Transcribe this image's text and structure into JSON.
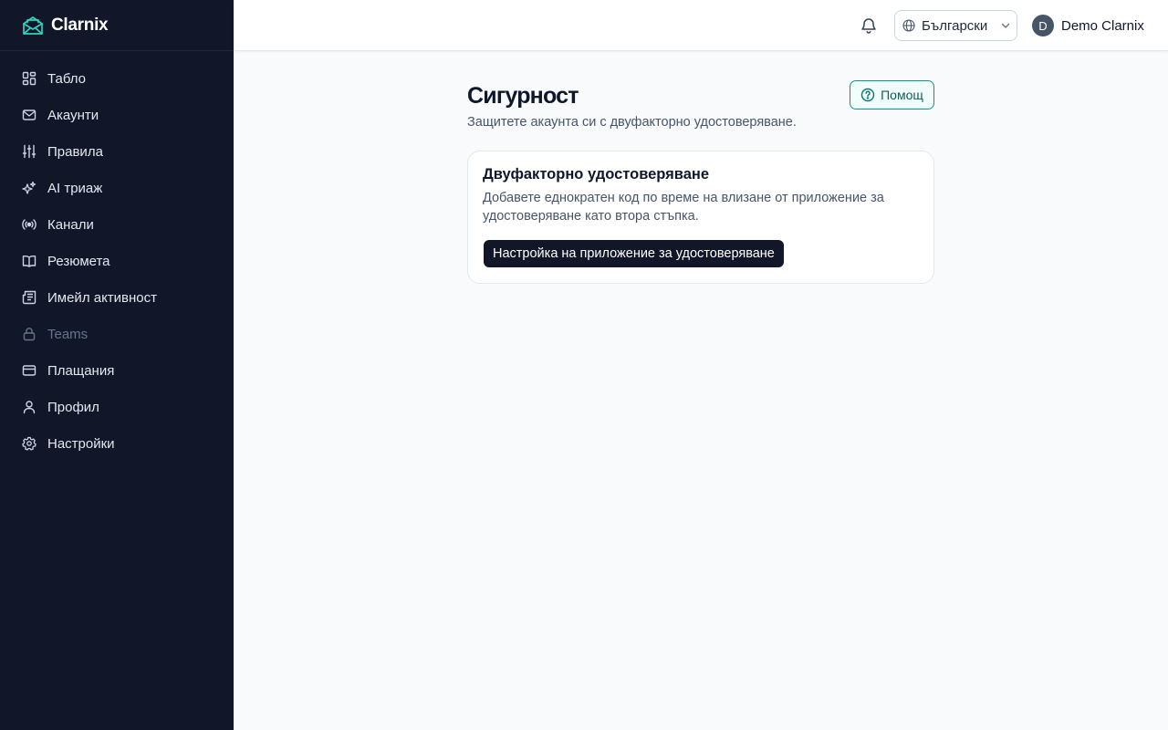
{
  "brand": {
    "name": "Clarnix",
    "accent": "#2dd4bf"
  },
  "sidebar": {
    "items": [
      {
        "label": "Табло",
        "icon": "dashboard-icon"
      },
      {
        "label": "Акаунти",
        "icon": "mail-icon"
      },
      {
        "label": "Правила",
        "icon": "sliders-icon"
      },
      {
        "label": "AI триаж",
        "icon": "sparkles-icon"
      },
      {
        "label": "Канали",
        "icon": "radio-icon"
      },
      {
        "label": "Резюмета",
        "icon": "book-icon"
      },
      {
        "label": "Имейл активност",
        "icon": "newspaper-icon"
      },
      {
        "label": "Teams",
        "icon": "lock-icon",
        "disabled": true
      },
      {
        "label": "Плащания",
        "icon": "credit-card-icon"
      },
      {
        "label": "Профил",
        "icon": "user-icon"
      },
      {
        "label": "Настройки",
        "icon": "gear-icon"
      }
    ]
  },
  "topbar": {
    "language": "Български",
    "user": {
      "initial": "D",
      "name": "Demo Clarnix"
    }
  },
  "page": {
    "title": "Сигурност",
    "subtitle": "Защитете акаунта си с двуфакторно удостоверяване.",
    "help_label": "Помощ"
  },
  "card": {
    "title": "Двуфакторно удостоверяване",
    "description": "Добавете еднократен код по време на влизане от приложение за удостоверяване като втора стъпка.",
    "button_label": "Настройка на приложение за удостоверяване"
  }
}
